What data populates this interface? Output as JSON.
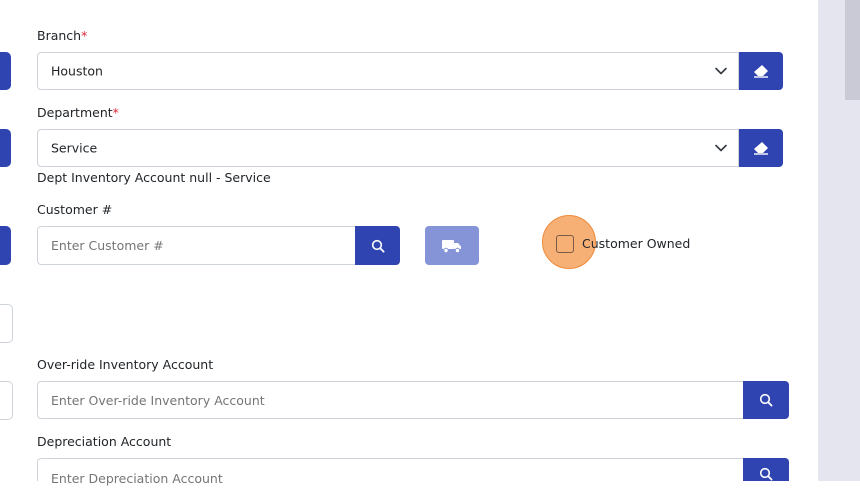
{
  "branch": {
    "label": "Branch",
    "required_mark": "*",
    "value": "Houston"
  },
  "department": {
    "label": "Department",
    "required_mark": "*",
    "value": "Service"
  },
  "dept_inventory_note": "Dept Inventory Account null - Service",
  "customer": {
    "label": "Customer #",
    "placeholder": "Enter Customer #",
    "customer_owned_label": "Customer Owned"
  },
  "override_inventory": {
    "label": "Over-ride Inventory Account",
    "placeholder": "Enter Over-ride Inventory Account"
  },
  "depreciation": {
    "label": "Depreciation Account",
    "placeholder": "Enter Depreciation Account"
  },
  "colors": {
    "primary": "#2f44b1",
    "primary_disabled": "#8594d6",
    "highlight": "#f5a25d"
  },
  "icons": [
    "eraser-icon",
    "chevron-down-icon",
    "search-icon",
    "truck-icon"
  ]
}
